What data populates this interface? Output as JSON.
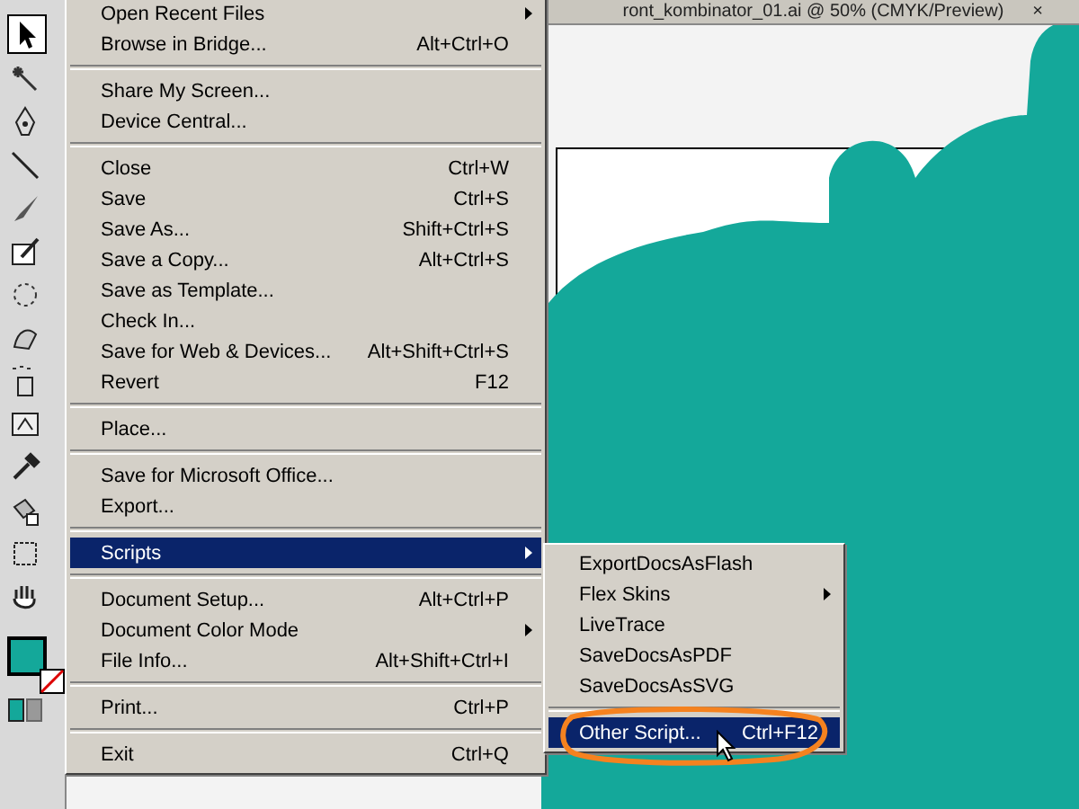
{
  "document": {
    "title": "ront_kombinator_01.ai  @ 50% (CMYK/Preview)",
    "close": "×"
  },
  "file_menu": [
    {
      "kind": "item",
      "label": "Open Recent Files",
      "submenu": true,
      "selected": false
    },
    {
      "kind": "item",
      "label": "Browse in Bridge...",
      "shortcut": "Alt+Ctrl+O",
      "selected": false
    },
    {
      "kind": "separator"
    },
    {
      "kind": "item",
      "label": "Share My Screen...",
      "selected": false
    },
    {
      "kind": "item",
      "label": "Device Central...",
      "selected": false
    },
    {
      "kind": "separator"
    },
    {
      "kind": "item",
      "label": "Close",
      "shortcut": "Ctrl+W",
      "selected": false
    },
    {
      "kind": "item",
      "label": "Save",
      "shortcut": "Ctrl+S",
      "selected": false
    },
    {
      "kind": "item",
      "label": "Save As...",
      "shortcut": "Shift+Ctrl+S",
      "selected": false
    },
    {
      "kind": "item",
      "label": "Save a Copy...",
      "shortcut": "Alt+Ctrl+S",
      "selected": false
    },
    {
      "kind": "item",
      "label": "Save as Template...",
      "selected": false
    },
    {
      "kind": "item",
      "label": "Check In...",
      "selected": false
    },
    {
      "kind": "item",
      "label": "Save for Web & Devices...",
      "shortcut": "Alt+Shift+Ctrl+S",
      "selected": false
    },
    {
      "kind": "item",
      "label": "Revert",
      "shortcut": "F12",
      "selected": false
    },
    {
      "kind": "separator"
    },
    {
      "kind": "item",
      "label": "Place...",
      "selected": false
    },
    {
      "kind": "separator"
    },
    {
      "kind": "item",
      "label": "Save for Microsoft Office...",
      "selected": false
    },
    {
      "kind": "item",
      "label": "Export...",
      "selected": false
    },
    {
      "kind": "separator"
    },
    {
      "kind": "item",
      "label": "Scripts",
      "submenu": true,
      "selected": true
    },
    {
      "kind": "separator"
    },
    {
      "kind": "item",
      "label": "Document Setup...",
      "shortcut": "Alt+Ctrl+P",
      "selected": false
    },
    {
      "kind": "item",
      "label": "Document Color Mode",
      "submenu": true,
      "selected": false
    },
    {
      "kind": "item",
      "label": "File Info...",
      "shortcut": "Alt+Shift+Ctrl+I",
      "selected": false
    },
    {
      "kind": "separator"
    },
    {
      "kind": "item",
      "label": "Print...",
      "shortcut": "Ctrl+P",
      "selected": false
    },
    {
      "kind": "separator"
    },
    {
      "kind": "item",
      "label": "Exit",
      "shortcut": "Ctrl+Q",
      "selected": false
    }
  ],
  "scripts_menu": [
    {
      "kind": "item",
      "label": "ExportDocsAsFlash",
      "selected": false
    },
    {
      "kind": "item",
      "label": "Flex Skins",
      "submenu": true,
      "selected": false
    },
    {
      "kind": "item",
      "label": "LiveTrace",
      "selected": false
    },
    {
      "kind": "item",
      "label": "SaveDocsAsPDF",
      "selected": false
    },
    {
      "kind": "item",
      "label": "SaveDocsAsSVG",
      "selected": false
    },
    {
      "kind": "separator"
    },
    {
      "kind": "item",
      "label": "Other Script...",
      "shortcut": "Ctrl+F12",
      "selected": true
    }
  ]
}
